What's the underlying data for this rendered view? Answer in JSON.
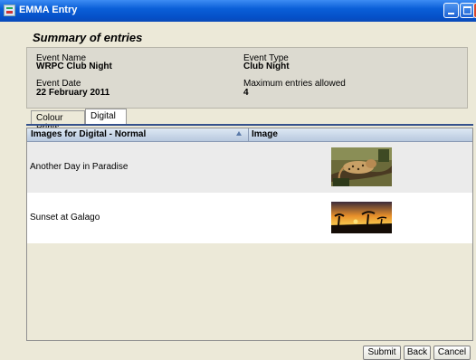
{
  "window": {
    "title": "EMMA Entry",
    "icon": "app-icon"
  },
  "heading": "Summary of entries",
  "event": {
    "name_label": "Event Name",
    "name": "WRPC Club Night",
    "type_label": "Event Type",
    "type": "Club Night",
    "date_label": "Event Date",
    "date": "22 February 2011",
    "max_label": "Maximum entries allowed",
    "max": "4"
  },
  "tabs": [
    {
      "label": "Colour Prints",
      "selected": false
    },
    {
      "label": "Digital",
      "selected": true
    }
  ],
  "table": {
    "columns": [
      "Images for Digital - Normal",
      "Image"
    ],
    "sort_icon": "sort-ascending-icon",
    "rows": [
      {
        "name": "Another Day in Paradise",
        "thumbnail": "leopard-on-branch"
      },
      {
        "name": "Sunset at Galago",
        "thumbnail": "sunset-silhouette"
      }
    ]
  },
  "buttons": {
    "submit": "Submit",
    "back": "Back",
    "cancel": "Cancel"
  }
}
